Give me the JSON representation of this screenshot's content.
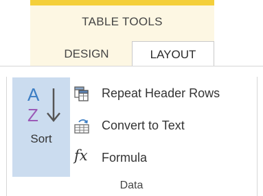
{
  "contextual_tab_group": {
    "title": "TABLE TOOLS",
    "accent_color": "#f4cf3a",
    "background_color": "#fdf7e3"
  },
  "tabs": [
    {
      "label": "DESIGN",
      "selected": false
    },
    {
      "label": "LAYOUT",
      "selected": true
    }
  ],
  "data_group": {
    "label": "Data",
    "sort_button": {
      "label": "Sort",
      "icon": "sort-az-icon",
      "highlighted": true,
      "highlight_color": "#cbdcef"
    },
    "buttons": [
      {
        "label": "Repeat Header Rows",
        "icon": "repeat-header-rows-icon"
      },
      {
        "label": "Convert to Text",
        "icon": "convert-to-text-icon"
      },
      {
        "label": "Formula",
        "icon": "formula-fx-icon",
        "icon_glyph": "fx"
      }
    ]
  }
}
